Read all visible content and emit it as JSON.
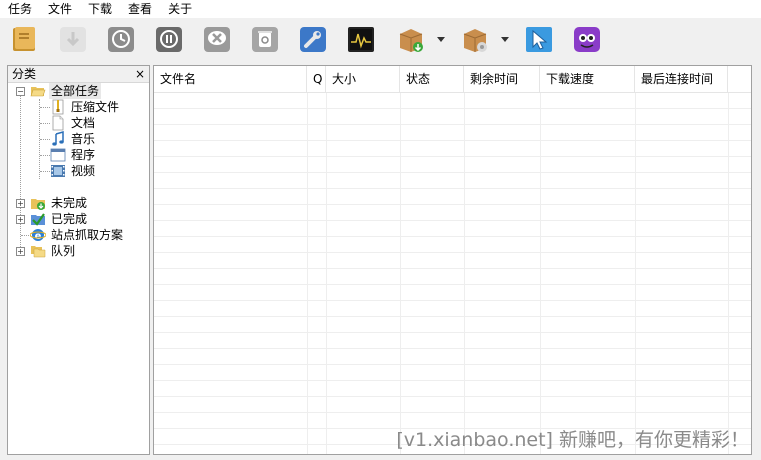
{
  "menu": [
    "任务",
    "文件",
    "下载",
    "查看",
    "关于"
  ],
  "panel": {
    "title": "分类",
    "close": "×"
  },
  "tree": {
    "all_tasks": "全部任务",
    "children": [
      "压缩文件",
      "文档",
      "音乐",
      "程序",
      "视频"
    ],
    "unfinished": "未完成",
    "finished": "已完成",
    "site_grab": "站点抓取方案",
    "queue": "队列"
  },
  "columns": [
    "文件名",
    "Q",
    "大小",
    "状态",
    "剩余时间",
    "下载速度",
    "最后连接时间"
  ],
  "watermark": "[v1.xianbao.net] 新赚吧，有你更精彩！"
}
